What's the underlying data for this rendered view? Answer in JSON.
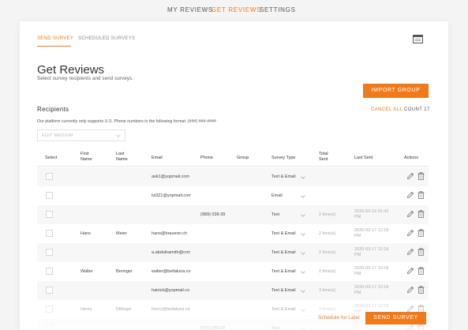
{
  "topnav": {
    "tabs": [
      {
        "label": "MY REVIEWS",
        "active": false
      },
      {
        "label": "GET REVIEWS",
        "active": true
      },
      {
        "label": "SETTINGS",
        "active": false
      }
    ]
  },
  "subtabs": [
    {
      "label": "SEND SURVEY",
      "active": true
    },
    {
      "label": "SCHEDULED SURVEYS",
      "active": false
    }
  ],
  "page": {
    "title": "Get Reviews",
    "subtitle": "Select survey recipients and send surveys."
  },
  "import_button": "IMPORT GROUP",
  "recipients": {
    "label": "Recipients",
    "cancel_all": "CANCEL ALL",
    "count": "COUNT 17",
    "phone_note": "Our platform currently only supports U.S. Phone numbers in the following format: (###) ###-####",
    "edit_medium_placeholder": "EDIT MEDIUM"
  },
  "table": {
    "headers": {
      "select": "Select",
      "first_name": "First\nName",
      "last_name": "Last\nName",
      "email": "Email",
      "phone": "Phone",
      "group": "Group",
      "survey_type": "Survey Type",
      "total_sent": "Total\nSent",
      "last_sent": "Last Sent",
      "actions": "Actions"
    },
    "rows": [
      {
        "first": "",
        "last": "",
        "email": "ask1@yopmail.com",
        "phone": "",
        "group": "",
        "survey_type": "Text & Email",
        "total_sent": "",
        "last_sent": ""
      },
      {
        "first": "",
        "last": "",
        "email": "lsl321@yopmail.com",
        "phone": "",
        "group": "",
        "survey_type": "Email",
        "total_sent": "",
        "last_sent": ""
      },
      {
        "first": "",
        "last": "",
        "email": "",
        "phone": "(989) 038-39",
        "group": "",
        "survey_type": "Text",
        "total_sent": "2 time(s)",
        "last_sent": "2020-03-16 01:42\nPM"
      },
      {
        "first": "Hans",
        "last": "Meier",
        "email": "hans@brauerei.ch",
        "phone": "",
        "group": "",
        "survey_type": "Text & Email",
        "total_sent": "2 time(s)",
        "last_sent": "2020-03-17 12:18\nPM"
      },
      {
        "first": "",
        "last": "",
        "email": "a.abdulnamith@cmi",
        "phone": "",
        "group": "",
        "survey_type": "Text & Email",
        "total_sent": "2 time(s)",
        "last_sent": "2020-03-17 12:18\nPM"
      },
      {
        "first": "Walter",
        "last": "Beringer",
        "email": "walter@bellaluna.co",
        "phone": "",
        "group": "",
        "survey_type": "Text & Email",
        "total_sent": "2 time(s)",
        "last_sent": "2020-03-17 12:18\nPM"
      },
      {
        "first": "",
        "last": "",
        "email": "hatrick@yopmail.co",
        "phone": "",
        "group": "",
        "survey_type": "Text & Email",
        "total_sent": "3 time(s)",
        "last_sent": "2020-03-17 12:18\nPM"
      },
      {
        "first": "Henry",
        "last": "Dillinger",
        "email": "henry@bellaluna.co",
        "phone": "",
        "group": "",
        "survey_type": "Text & Email",
        "total_sent": "2 time(s)",
        "last_sent": "2020-03-17 12:18\nPM"
      },
      {
        "first": "",
        "last": "",
        "email": "",
        "phone": "(970) 050-39",
        "group": "",
        "survey_type": "Text",
        "total_sent": "",
        "last_sent": ""
      }
    ]
  },
  "footer": {
    "schedule_later": "Schedule for Later",
    "send_survey": "SEND SURVEY"
  },
  "colors": {
    "accent": "#f07a1a",
    "row_alt": "#f7f7f7"
  },
  "icons": {
    "window": "window-icon",
    "edit": "pencil-icon",
    "delete": "trash-icon",
    "dropdown": "chevron-down-icon"
  }
}
